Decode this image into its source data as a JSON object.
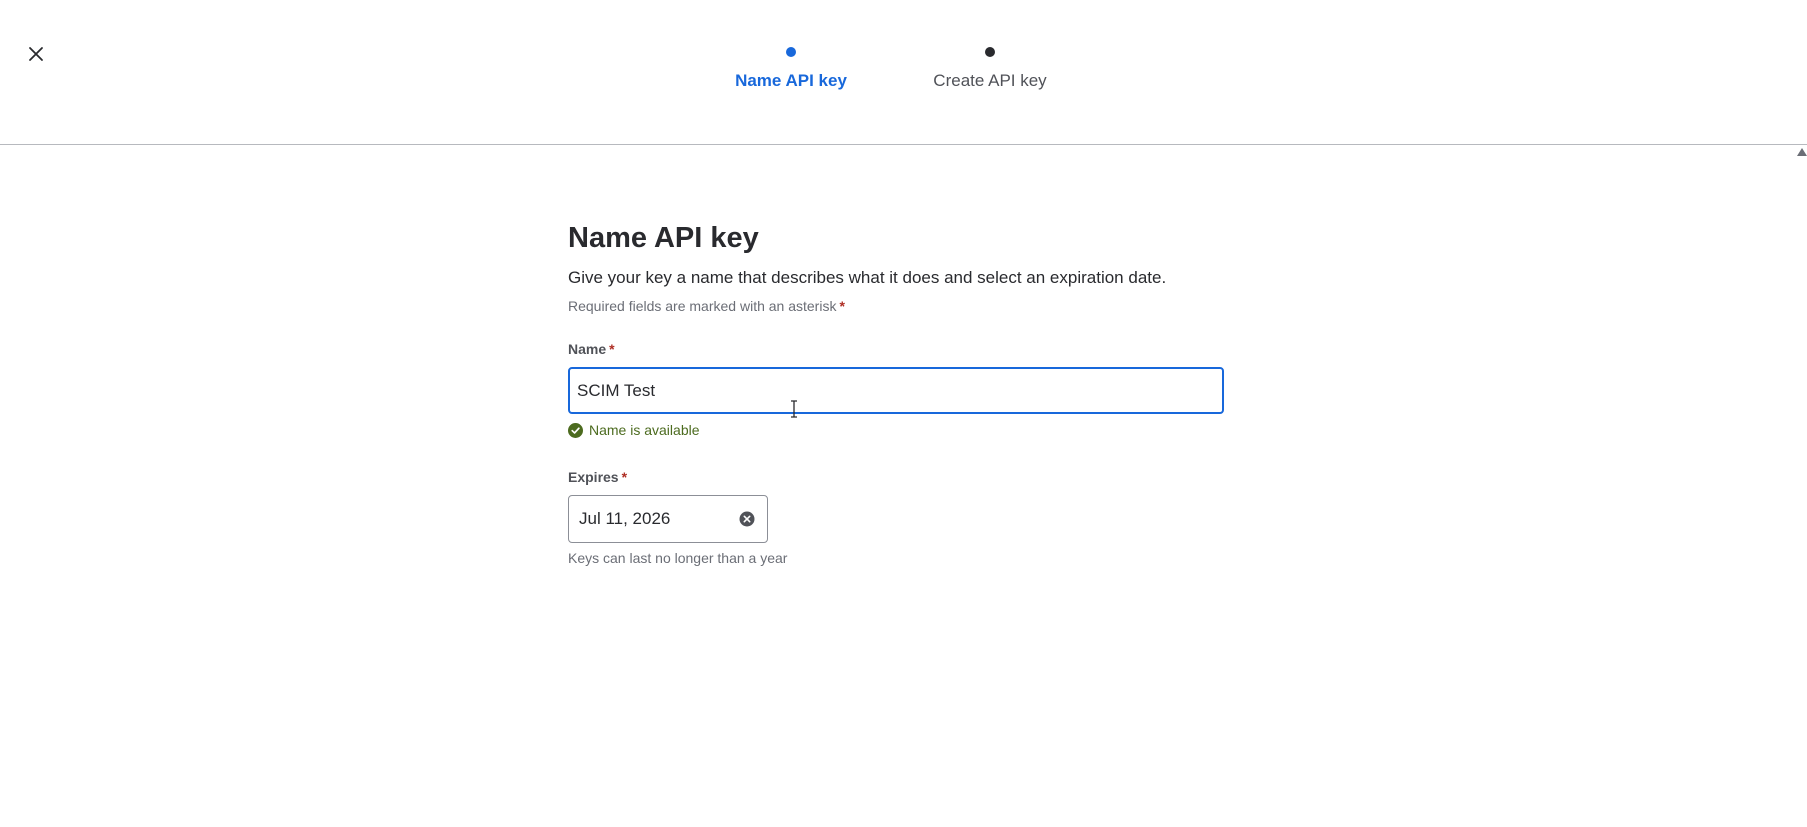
{
  "stepper": {
    "steps": [
      {
        "label": "Name API key",
        "active": true
      },
      {
        "label": "Create API key",
        "active": false
      }
    ]
  },
  "form": {
    "title": "Name API key",
    "description": "Give your key a name that describes what it does and select an expiration date.",
    "required_note": "Required fields are marked with an asterisk",
    "asterisk": "*",
    "name": {
      "label": "Name",
      "value": "SCIM Test",
      "validation": "Name is available"
    },
    "expires": {
      "label": "Expires",
      "value": "Jul 11, 2026",
      "helper": "Keys can last no longer than a year"
    }
  },
  "icons": {
    "close": "close-icon",
    "check": "check-circle-icon",
    "clear": "clear-circle-icon"
  },
  "colors": {
    "accent": "#1868db",
    "success": "#4c6b1f",
    "required": "#ae2e24",
    "text": "#292a2e",
    "subtle_text": "#6b6e76"
  }
}
